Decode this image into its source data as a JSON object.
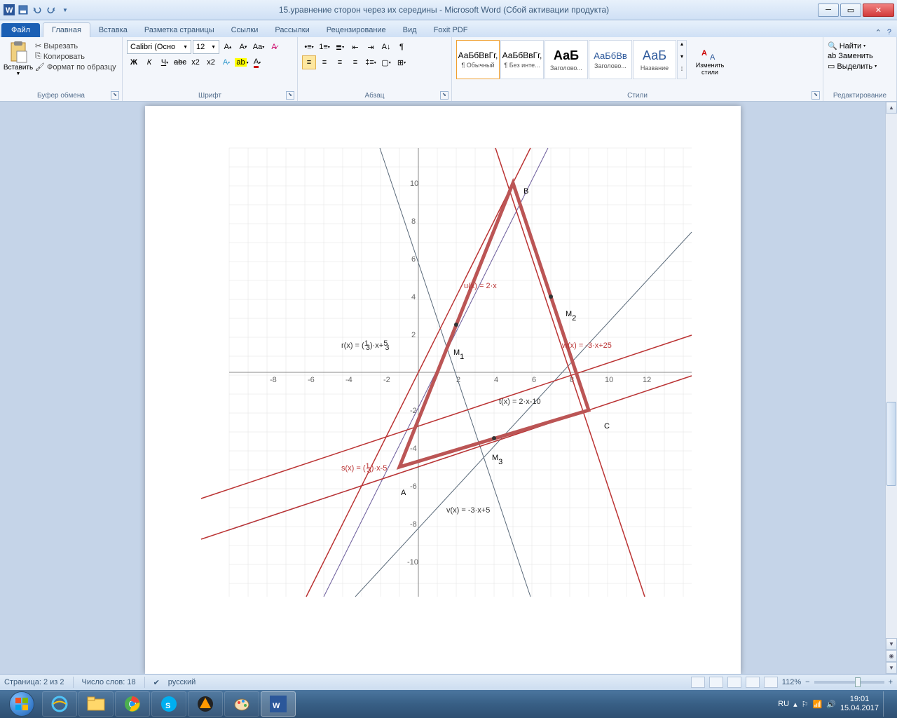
{
  "window": {
    "title": "15.уравнение сторон через их середины - Microsoft Word (Сбой активации продукта)"
  },
  "tabs": {
    "file": "Файл",
    "items": [
      "Главная",
      "Вставка",
      "Разметка страницы",
      "Ссылки",
      "Рассылки",
      "Рецензирование",
      "Вид",
      "Foxit PDF"
    ],
    "active": 0
  },
  "ribbon": {
    "clipboard": {
      "paste": "Вставить",
      "cut": "Вырезать",
      "copy": "Копировать",
      "format": "Формат по образцу",
      "label": "Буфер обмена"
    },
    "font": {
      "name": "Calibri (Осно",
      "size": "12",
      "label": "Шрифт"
    },
    "paragraph": {
      "label": "Абзац"
    },
    "styles": {
      "label": "Стили",
      "change": "Изменить стили",
      "items": [
        {
          "preview": "АаБбВвГг,",
          "label": "¶ Обычный"
        },
        {
          "preview": "АаБбВвГг,",
          "label": "¶ Без инте..."
        },
        {
          "preview": "АаБ",
          "label": "Заголово..."
        },
        {
          "preview": "АаБбВв",
          "label": "Заголово..."
        },
        {
          "preview": "АаБ",
          "label": "Название"
        }
      ]
    },
    "editing": {
      "find": "Найти",
      "replace": "Заменить",
      "select": "Выделить",
      "label": "Редактирование"
    }
  },
  "statusbar": {
    "page": "Страница: 2 из 2",
    "words": "Число слов: 18",
    "lang": "русский",
    "zoom": "112%"
  },
  "tray": {
    "lang": "RU",
    "time": "19:01",
    "date": "15.04.2017"
  },
  "chart_data": {
    "type": "line",
    "title": "",
    "xlim": [
      -10,
      15
    ],
    "ylim": [
      -12,
      12
    ],
    "grid": true,
    "points": [
      {
        "name": "A",
        "x": -1,
        "y": -5
      },
      {
        "name": "B",
        "x": 5,
        "y": 10
      },
      {
        "name": "C",
        "x": 9,
        "y": -2
      },
      {
        "name": "M1",
        "x": 2,
        "y": 2.5
      },
      {
        "name": "M2",
        "x": 7,
        "y": 4
      },
      {
        "name": "M3",
        "x": 4,
        "y": -3.5
      }
    ],
    "triangle": [
      "A",
      "B",
      "C"
    ],
    "lines": [
      {
        "label": "u(x) = 2·x",
        "color": "#b33"
      },
      {
        "label": "w(x) = -3·x+25",
        "color": "#b33"
      },
      {
        "label": "t(x) = 2·x-10",
        "color": "#556"
      },
      {
        "label": "v(x) = -3·x+5",
        "color": "#556"
      },
      {
        "label": "s(x) = (1/3)·x-5",
        "color": "#b33"
      },
      {
        "label": "r(x) = (1/3)·x+5/3",
        "color": "#556"
      }
    ]
  }
}
